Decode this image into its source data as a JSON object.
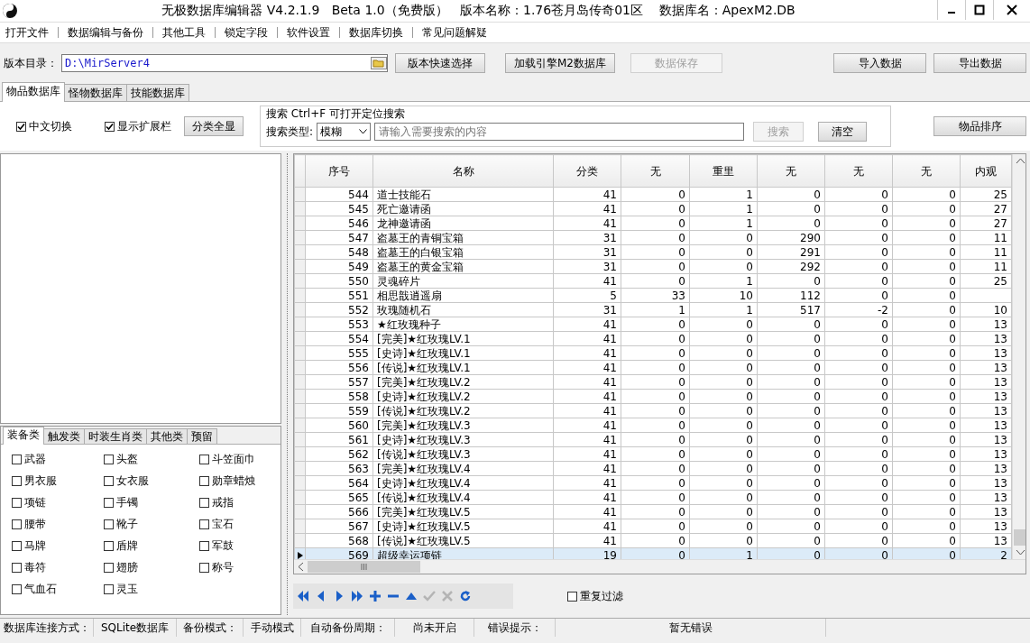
{
  "window": {
    "title": "无极数据库编辑器 V4.2.1.9   Beta 1.0（免费版）   版本名称：1.76苍月岛传奇01区    数据库名：ApexM2.DB"
  },
  "menu": [
    "打开文件",
    "数据编辑与备份",
    "其他工具",
    "锁定字段",
    "软件设置",
    "数据库切换",
    "常见问题解疑"
  ],
  "toolbar": {
    "dir_label": "版本目录：",
    "dir_value": "D:\\MirServer4",
    "buttons": [
      {
        "label": "版本快速选择",
        "disabled": false
      },
      {
        "label": "加载引擎M2数据库",
        "disabled": false
      },
      {
        "label": "数据保存",
        "disabled": true
      },
      {
        "label": "导入数据",
        "disabled": false
      },
      {
        "label": "导出数据",
        "disabled": false
      }
    ]
  },
  "tabs": [
    {
      "label": "物品数据库",
      "selected": true
    },
    {
      "label": "怪物数据库",
      "selected": false
    },
    {
      "label": "技能数据库",
      "selected": false
    }
  ],
  "options": {
    "checks": [
      {
        "label": "中文切换",
        "checked": true
      },
      {
        "label": "显示扩展栏",
        "checked": true
      }
    ],
    "show_all": "分类全显"
  },
  "search": {
    "title": "搜索   Ctrl+F 可打开定位搜索",
    "type_label": "搜索类型:",
    "type_value": "模糊",
    "placeholder": "请输入需要搜索的内容",
    "search_button": {
      "label": "搜索",
      "disabled": true
    },
    "clear_button": {
      "label": "清空",
      "disabled": false
    }
  },
  "sort_button": "物品排序",
  "category_tabs": [
    {
      "label": "装备类",
      "selected": true
    },
    {
      "label": "触发类",
      "selected": false
    },
    {
      "label": "时装生肖类",
      "selected": false
    },
    {
      "label": "其他类",
      "selected": false
    },
    {
      "label": "预留",
      "selected": false
    }
  ],
  "categories": [
    {
      "label": "武器",
      "checked": false
    },
    {
      "label": "头盔",
      "checked": false
    },
    {
      "label": "斗笠面巾",
      "checked": false
    },
    {
      "label": "男衣服",
      "checked": false
    },
    {
      "label": "女衣服",
      "checked": false
    },
    {
      "label": "勋章蜡烛",
      "checked": false
    },
    {
      "label": "项链",
      "checked": false
    },
    {
      "label": "手镯",
      "checked": false
    },
    {
      "label": "戒指",
      "checked": false
    },
    {
      "label": "腰带",
      "checked": false
    },
    {
      "label": "靴子",
      "checked": false
    },
    {
      "label": "宝石",
      "checked": false
    },
    {
      "label": "马牌",
      "checked": false
    },
    {
      "label": "盾牌",
      "checked": false
    },
    {
      "label": "军鼓",
      "checked": false
    },
    {
      "label": "毒符",
      "checked": false
    },
    {
      "label": "翅膀",
      "checked": false
    },
    {
      "label": "称号",
      "checked": false
    },
    {
      "label": "气血石",
      "checked": false
    },
    {
      "label": "灵玉",
      "checked": false
    }
  ],
  "table": {
    "columns": [
      "序号",
      "名称",
      "分类",
      "无",
      "重里",
      "无",
      "无",
      "无",
      "内观"
    ],
    "rows": [
      {
        "cells": [
          "544",
          "道士技能石",
          "41",
          "0",
          "1",
          "0",
          "0",
          "0",
          "25"
        ],
        "selected": false
      },
      {
        "cells": [
          "545",
          "死亡邀请函",
          "41",
          "0",
          "1",
          "0",
          "0",
          "0",
          "27"
        ],
        "selected": false
      },
      {
        "cells": [
          "546",
          "龙神邀请函",
          "41",
          "0",
          "1",
          "0",
          "0",
          "0",
          "27"
        ],
        "selected": false
      },
      {
        "cells": [
          "547",
          "盗墓王的青铜宝箱",
          "31",
          "0",
          "0",
          "290",
          "0",
          "0",
          "11"
        ],
        "selected": false
      },
      {
        "cells": [
          "548",
          "盗墓王的白银宝箱",
          "31",
          "0",
          "0",
          "291",
          "0",
          "0",
          "11"
        ],
        "selected": false
      },
      {
        "cells": [
          "549",
          "盗墓王的黄金宝箱",
          "31",
          "0",
          "0",
          "292",
          "0",
          "0",
          "11"
        ],
        "selected": false
      },
      {
        "cells": [
          "550",
          "灵魂碎片",
          "41",
          "0",
          "1",
          "0",
          "0",
          "0",
          "25"
        ],
        "selected": false
      },
      {
        "cells": [
          "551",
          "相思戠逍遥扇",
          "5",
          "33",
          "10",
          "112",
          "0",
          "0"
        ],
        "selected": false
      },
      {
        "cells": [
          "552",
          "玫瑰随机石",
          "31",
          "1",
          "1",
          "517",
          "-2",
          "0",
          "10"
        ],
        "selected": false
      },
      {
        "cells": [
          "553",
          "★红玫瑰种子",
          "41",
          "0",
          "0",
          "0",
          "0",
          "0",
          "13"
        ],
        "selected": false
      },
      {
        "cells": [
          "554",
          "[完美]★红玫瑰LV.1",
          "41",
          "0",
          "0",
          "0",
          "0",
          "0",
          "13"
        ],
        "selected": false
      },
      {
        "cells": [
          "555",
          "[史诗]★红玫瑰LV.1",
          "41",
          "0",
          "0",
          "0",
          "0",
          "0",
          "13"
        ],
        "selected": false
      },
      {
        "cells": [
          "556",
          "[传说]★红玫瑰LV.1",
          "41",
          "0",
          "0",
          "0",
          "0",
          "0",
          "13"
        ],
        "selected": false
      },
      {
        "cells": [
          "557",
          "[完美]★红玫瑰LV.2",
          "41",
          "0",
          "0",
          "0",
          "0",
          "0",
          "13"
        ],
        "selected": false
      },
      {
        "cells": [
          "558",
          "[史诗]★红玫瑰LV.2",
          "41",
          "0",
          "0",
          "0",
          "0",
          "0",
          "13"
        ],
        "selected": false
      },
      {
        "cells": [
          "559",
          "[传说]★红玫瑰LV.2",
          "41",
          "0",
          "0",
          "0",
          "0",
          "0",
          "13"
        ],
        "selected": false
      },
      {
        "cells": [
          "560",
          "[完美]★红玫瑰LV.3",
          "41",
          "0",
          "0",
          "0",
          "0",
          "0",
          "13"
        ],
        "selected": false
      },
      {
        "cells": [
          "561",
          "[史诗]★红玫瑰LV.3",
          "41",
          "0",
          "0",
          "0",
          "0",
          "0",
          "13"
        ],
        "selected": false
      },
      {
        "cells": [
          "562",
          "[传说]★红玫瑰LV.3",
          "41",
          "0",
          "0",
          "0",
          "0",
          "0",
          "13"
        ],
        "selected": false
      },
      {
        "cells": [
          "563",
          "[完美]★红玫瑰LV.4",
          "41",
          "0",
          "0",
          "0",
          "0",
          "0",
          "13"
        ],
        "selected": false
      },
      {
        "cells": [
          "564",
          "[史诗]★红玫瑰LV.4",
          "41",
          "0",
          "0",
          "0",
          "0",
          "0",
          "13"
        ],
        "selected": false
      },
      {
        "cells": [
          "565",
          "[传说]★红玫瑰LV.4",
          "41",
          "0",
          "0",
          "0",
          "0",
          "0",
          "13"
        ],
        "selected": false
      },
      {
        "cells": [
          "566",
          "[完美]★红玫瑰LV.5",
          "41",
          "0",
          "0",
          "0",
          "0",
          "0",
          "13"
        ],
        "selected": false
      },
      {
        "cells": [
          "567",
          "[史诗]★红玫瑰LV.5",
          "41",
          "0",
          "0",
          "0",
          "0",
          "0",
          "13"
        ],
        "selected": false
      },
      {
        "cells": [
          "568",
          "[传说]★红玫瑰LV.5",
          "41",
          "0",
          "0",
          "0",
          "0",
          "0",
          "13"
        ],
        "selected": false
      },
      {
        "cells": [
          "569",
          "超级幸运项链",
          "19",
          "0",
          "1",
          "0",
          "0",
          "0",
          "2"
        ],
        "selected": true
      }
    ]
  },
  "navigator": [
    {
      "kind": "first",
      "disabled": false
    },
    {
      "kind": "prev",
      "disabled": false
    },
    {
      "kind": "next",
      "disabled": false
    },
    {
      "kind": "last",
      "disabled": false
    },
    {
      "kind": "add",
      "disabled": false
    },
    {
      "kind": "delete",
      "disabled": false
    },
    {
      "kind": "up",
      "disabled": false
    },
    {
      "kind": "post",
      "disabled": true
    },
    {
      "kind": "cancel",
      "disabled": true
    },
    {
      "kind": "refresh",
      "disabled": false
    }
  ],
  "dedupe": {
    "label": "重复过滤",
    "checked": false
  },
  "status_bar": [
    "数据库连接方式：",
    "SQLite数据库",
    "备份模式：",
    "手动模式",
    "自动备份周期：",
    "尚未开启",
    "错误提示：",
    "暂无错误"
  ]
}
